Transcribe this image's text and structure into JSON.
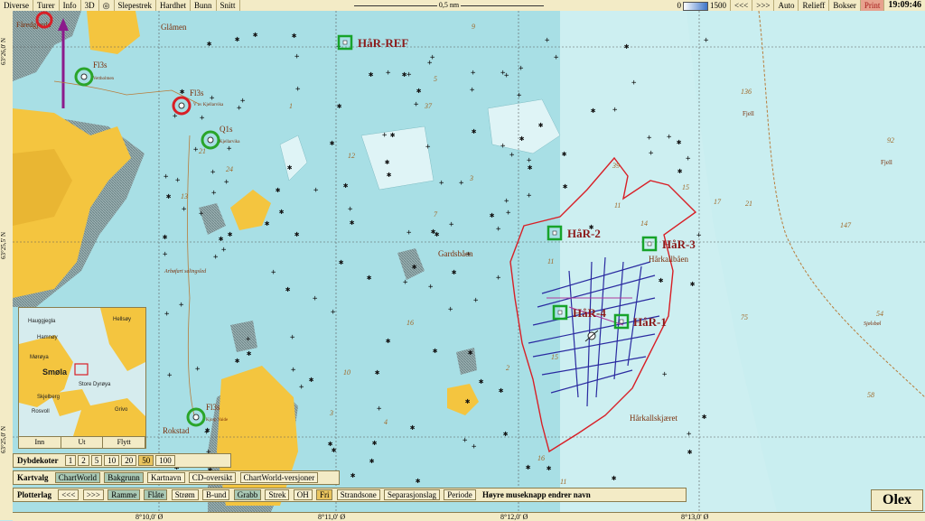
{
  "menu": [
    "Diverse",
    "Turer",
    "Info",
    "3D",
    "Slepestrek",
    "Hardhet",
    "Bunn",
    "Snitt"
  ],
  "scale_label": "0,5 nm",
  "depth_scale": {
    "min": "0",
    "max": "1500"
  },
  "right_menu": [
    "<<<",
    ">>>",
    "Auto",
    "Relieff",
    "Bokser"
  ],
  "print_label": "Print",
  "clock": "19:09:46",
  "lat_labels": [
    "63°26,0' N",
    "63°25,5' N",
    "63°25,0' N"
  ],
  "lon_labels": [
    "8°10,0' Ø",
    "8°11,0' Ø",
    "8°12,0' Ø",
    "8°13,0' Ø"
  ],
  "markers": [
    {
      "name": "HåR-REF"
    },
    {
      "name": "HåR-2"
    },
    {
      "name": "HåR-3"
    },
    {
      "name": "HåR-4"
    },
    {
      "name": "HåR-1"
    }
  ],
  "lights": [
    {
      "label": "Fl3s",
      "sub": "Vettholmen"
    },
    {
      "label": "Fl3s",
      "sub": "V av Kjellarvika"
    },
    {
      "label": "Q1s",
      "sub": "Kjellarvika"
    },
    {
      "label": "Fl3s",
      "sub": "Kjorp Vaide"
    }
  ],
  "place_names": [
    "Glåmen",
    "Gardsbåen",
    "Hårkallbåen",
    "Hårkallskjæret",
    "Rokstad",
    "Fjell",
    "Fjell",
    "Sjølsbøl",
    "Arbøfart selingsled",
    "Fåredgjerda"
  ],
  "depths": [
    "9",
    "5",
    "3",
    "2",
    "1",
    "7",
    "13",
    "24",
    "15",
    "11",
    "16",
    "12",
    "3",
    "4",
    "21",
    "37",
    "10",
    "39",
    "11",
    "14",
    "15",
    "17",
    "21",
    "75",
    "136",
    "147",
    "92",
    "54",
    "58",
    "16",
    "11"
  ],
  "dybdekoter": {
    "title": "Dybdekoter",
    "values": [
      "1",
      "2",
      "5",
      "10",
      "20",
      "50",
      "100"
    ],
    "active": "50"
  },
  "kartvalg": {
    "title": "Kartvalg",
    "items": [
      "ChartWorld",
      "Bakgrunn",
      "Kartnavn",
      "CD-oversikt",
      "ChartWorld-versjoner"
    ]
  },
  "plotterlag": {
    "title": "Plotterlag",
    "items": [
      "<<<",
      ">>>",
      "Ramme",
      "Flåte",
      "Strøm",
      "B-und",
      "Grabb",
      "Strek",
      "OH",
      "Fri",
      "Strandsone",
      "Separasjonslag",
      "Periode",
      "Høyre museknapp endrer navn"
    ]
  },
  "inset": {
    "names": [
      "Hauggjegla",
      "Hellsøy",
      "Hamnøy",
      "Mørøya",
      "Smøla",
      "Skjelberg",
      "Store Dyrøya",
      "Rosvoll",
      "Grivo"
    ],
    "buttons": [
      "Inn",
      "Ut",
      "Flytt"
    ]
  },
  "brand": "Olex",
  "colors": {
    "land": "#f4c53f",
    "shallow": "#b7e7eb",
    "deep": "#d0f0f2",
    "survey": "#d81f26",
    "track": "#2a2aa0",
    "marker": "#17a32a"
  }
}
